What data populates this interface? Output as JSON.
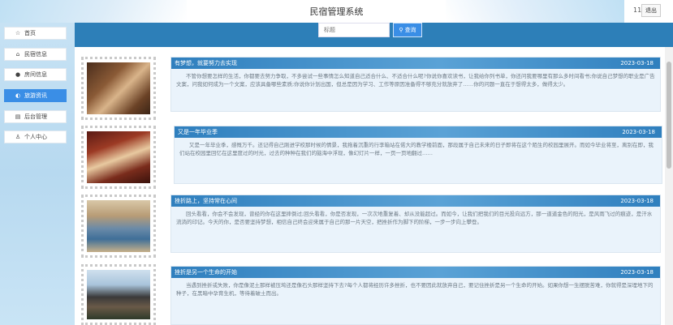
{
  "header": {
    "title": "民宿管理系统",
    "user_number": "11",
    "logout_label": "退出"
  },
  "search": {
    "placeholder": "标题",
    "button_label": "查询"
  },
  "sidebar": {
    "items": [
      {
        "label": "首页",
        "icon": "star-icon",
        "glyph": "☆",
        "active": false
      },
      {
        "label": "民宿信息",
        "icon": "home-icon",
        "glyph": "⌂",
        "active": false
      },
      {
        "label": "房间信息",
        "icon": "info-icon",
        "glyph": "●",
        "active": false
      },
      {
        "label": "旅游资讯",
        "icon": "toggle-icon",
        "glyph": "◐",
        "active": true
      },
      {
        "label": "后台管理",
        "icon": "list-icon",
        "glyph": "▤",
        "active": false
      },
      {
        "label": "个人中心",
        "icon": "user-icon",
        "glyph": "♙",
        "active": false
      }
    ]
  },
  "posts": [
    {
      "title": "有梦想，就要努力去实现",
      "date": "2023-03-18",
      "body": "不管你想要怎样的生活，你都要去努力争取，不多尝试一些事情怎么知道自己适合什么、不适合什么呢?你说你喜欢读书，让我给你列书单，你还问我要哪里有那么多时间看书;你说自己梦想的职业是广告文案，问我如何成为一个文案，应该具备哪些素质;你说你计划出国，但总是因为学习、工作等原因准备得不够充分就放弃了……你的问题一直在于想得太多，做得太少。"
    },
    {
      "title": "又是一年毕业季",
      "date": "2023-03-18",
      "body": "又是一年毕业季，感慨万千。还记得自己刚进学校那时候的情景，我拖着沉重的行李箱站在偌大的教学楼前面，那段属于自己未来的日子即将在这个陌生的校园里展开。而如今毕业将至，离别在即，我们站在校园里回忆在这里度过的时光，过去的种种在我们的脑海中浮现，像幻灯片一样，一页一页地翻过……"
    },
    {
      "title": "挫折路上，坚持常在心间",
      "date": "2023-03-18",
      "body": "回头看看，你会不会发现，曾经的你在这里摔倒过;回头看看，你是否发现，一次次地重复着、却从没能超过。而如今，让我们把我们的目光投向远方，那一道道金色的阳光，是风雨飞过的痕迹，是汗水流淌的印记。今天的你，是否要坚持梦想，相信自己终会迎来属于自己的那一片天空，把挫折作为脚下的阶梯，一步一步向上攀登。"
    },
    {
      "title": "挫折是另一个生命的开始",
      "date": "2023-03-18",
      "body": "当遇到挫折或失败，你是像泥土那样被压垮还是像石头那样坚持下去?每个人都将经历许多挫折，也不要因此就放弃自己，要记住挫折是另一个生命的开始。如果你想一生摆脱苦难，你就得是深埋地下的种子，在黑暗中孕育生机，等待着破土而出。"
    }
  ]
}
